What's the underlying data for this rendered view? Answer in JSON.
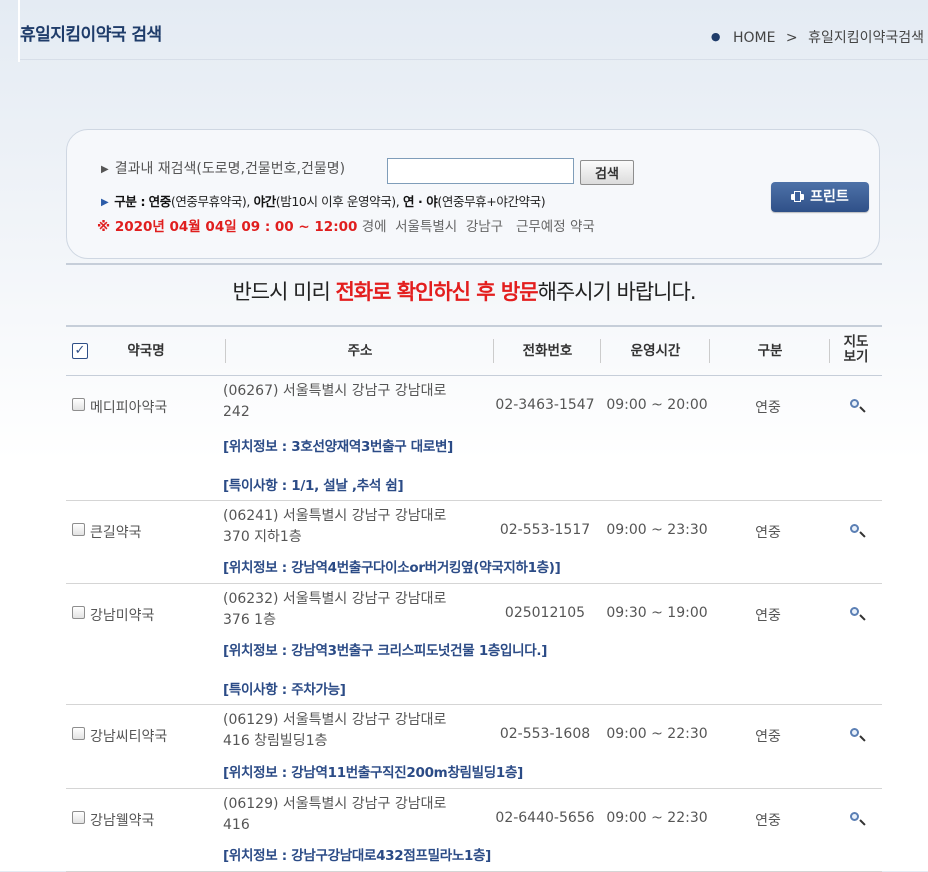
{
  "header": {
    "title": "휴일지킴이약국 검색",
    "breadcrumb": {
      "home": "HOME",
      "separator": ">",
      "current": "휴일지킴이약국검색"
    }
  },
  "search": {
    "label": "결과내 재검색(도로명,건물번호,건물명)",
    "input_value": "",
    "button_label": "검색",
    "legend": {
      "prefix": "구분 :",
      "t1": "연중",
      "t1_desc": "(연중무휴약국),",
      "t2": "야간",
      "t2_desc": "(밤10시 이후 운영약국),",
      "t3": "연 · 야",
      "t3_desc": "(연중무휴+야간약국)"
    },
    "condition": {
      "mark_date_time": "※ 2020년 04월 04일 09 : 00 ~ 12:00",
      "suffix": "경에",
      "city": "서울특별시",
      "district": "강남구",
      "status": "근무예정 약국"
    },
    "print_label": "프린트"
  },
  "notice": {
    "before": "반드시 미리 ",
    "highlight": "전화로 확인하신 후 방문",
    "after": "해주시기 바랍니다."
  },
  "table": {
    "columns": {
      "name": "약국명",
      "address": "주소",
      "phone": "전화번호",
      "hours": "운영시간",
      "type": "구분",
      "map_line1": "지도",
      "map_line2": "보기"
    },
    "rows": [
      {
        "name": "메디피아약국",
        "addr1": "(06267) 서울특별시 강남구 강남대로",
        "addr2": "242",
        "phone": "02-3463-1547",
        "hours": "09:00 ~ 20:00",
        "type": "연중",
        "location": "[위치정보 : 3호선양재역3번출구 대로변]",
        "note": "[특이사항 : 1/1, 설날 ,추석 쉼]"
      },
      {
        "name": "큰길약국",
        "addr1": "(06241) 서울특별시 강남구 강남대로",
        "addr2": "370 지하1층",
        "phone": "02-553-1517",
        "hours": "09:00 ~ 23:30",
        "type": "연중",
        "location": "[위치정보 : 강남역4번출구다이소or버거킹옆(약국지하1층)]",
        "note": ""
      },
      {
        "name": "강남미약국",
        "addr1": "(06232) 서울특별시 강남구 강남대로",
        "addr2": "376 1층",
        "phone": "025012105",
        "hours": "09:30 ~ 19:00",
        "type": "연중",
        "location": "[위치정보 : 강남역3번출구 크리스피도넛건물 1층입니다.]",
        "note": "[특이사항 : 주차가능]"
      },
      {
        "name": "강남씨티약국",
        "addr1": "(06129) 서울특별시 강남구 강남대로",
        "addr2": "416 창림빌딩1층",
        "phone": "02-553-1608",
        "hours": "09:00 ~ 22:30",
        "type": "연중",
        "location": "[위치정보 : 강남역11번출구직진200m창림빌딩1층]",
        "note": ""
      },
      {
        "name": "강남웰약국",
        "addr1": "(06129) 서울특별시 강남구 강남대로",
        "addr2": "416",
        "phone": "02-6440-5656",
        "hours": "09:00 ~ 22:30",
        "type": "연중",
        "location": "[위치정보 : 강남구강남대로432점프밀라노1층]",
        "note": ""
      }
    ]
  }
}
